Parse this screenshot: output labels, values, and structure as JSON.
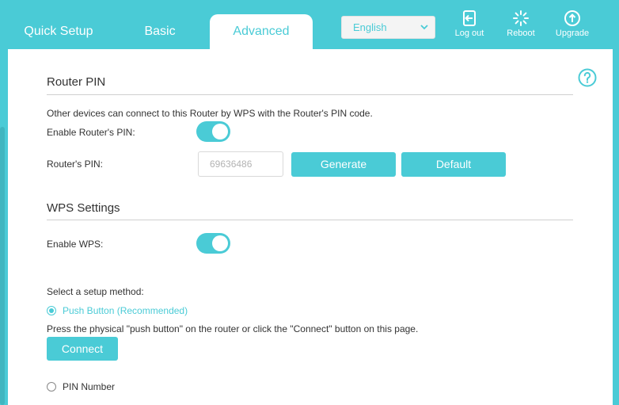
{
  "nav": {
    "tabs": [
      {
        "label": "Quick Setup"
      },
      {
        "label": "Basic"
      },
      {
        "label": "Advanced"
      }
    ],
    "language": {
      "selected": "English"
    },
    "tools": {
      "logout": "Log out",
      "reboot": "Reboot",
      "upgrade": "Upgrade"
    }
  },
  "router_pin": {
    "title": "Router PIN",
    "description": "Other devices can connect to this Router by WPS with the Router's PIN code.",
    "enable_label": "Enable Router's PIN:",
    "enabled": true,
    "pin_label": "Router's PIN:",
    "pin_value": "69636486",
    "generate_label": "Generate",
    "default_label": "Default"
  },
  "wps": {
    "title": "WPS Settings",
    "enable_label": "Enable WPS:",
    "enabled": true,
    "setup_method_label": "Select a setup method:",
    "push_button_label": "Push Button (Recommended)",
    "push_button_desc": "Press the physical \"push button\" on the router or click the \"Connect\" button on this page.",
    "connect_label": "Connect",
    "pin_number_label": "PIN Number"
  },
  "colors": {
    "accent": "#4acbd6",
    "text": "#333333",
    "rule": "#cfcfcf"
  }
}
